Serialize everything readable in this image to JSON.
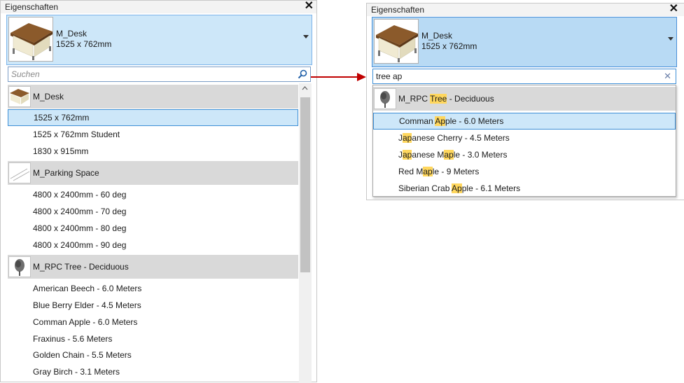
{
  "left_panel": {
    "title": "Eigenschaften",
    "close_glyph": "✕",
    "selector": {
      "name": "M_Desk",
      "size": "1525 x 762mm"
    },
    "search": {
      "placeholder": "Suchen",
      "value": ""
    },
    "list": [
      {
        "kind": "group",
        "label": "M_Desk",
        "thumb": "desk-thumbnail"
      },
      {
        "kind": "item",
        "label": "1525 x 762mm",
        "selected": true
      },
      {
        "kind": "item",
        "label": "1525 x 762mm Student"
      },
      {
        "kind": "item",
        "label": "1830 x 915mm"
      },
      {
        "kind": "group",
        "label": "M_Parking Space",
        "thumb": "parking-thumbnail"
      },
      {
        "kind": "item",
        "label": "4800 x 2400mm - 60 deg"
      },
      {
        "kind": "item",
        "label": "4800 x 2400mm - 70 deg"
      },
      {
        "kind": "item",
        "label": "4800 x 2400mm - 80 deg"
      },
      {
        "kind": "item",
        "label": "4800 x 2400mm - 90 deg"
      },
      {
        "kind": "group",
        "label": "M_RPC Tree - Deciduous",
        "thumb": "tree-thumbnail"
      },
      {
        "kind": "item",
        "label": "American Beech - 6.0 Meters"
      },
      {
        "kind": "item",
        "label": "Blue Berry Elder - 4.5 Meters"
      },
      {
        "kind": "item",
        "label": "Comman Apple - 6.0 Meters"
      },
      {
        "kind": "item",
        "label": "Fraxinus - 5.6 Meters"
      },
      {
        "kind": "item",
        "label": "Golden Chain - 5.5 Meters"
      },
      {
        "kind": "item",
        "label": "Gray Birch - 3.1 Meters"
      }
    ]
  },
  "right_panel": {
    "title": "Eigenschaften",
    "close_glyph": "✕",
    "selector": {
      "name": "M_Desk",
      "size": "1525 x 762mm"
    },
    "search": {
      "placeholder": "",
      "value": "tree ap",
      "clear_glyph": "✕"
    },
    "list": [
      {
        "kind": "group",
        "thumb": "tree-thumbnail",
        "parts": [
          [
            "M_RPC ",
            false
          ],
          [
            "Tree",
            true
          ],
          [
            " - Deciduous",
            false
          ]
        ]
      },
      {
        "kind": "item",
        "selected": true,
        "parts": [
          [
            "Comman ",
            false
          ],
          [
            "Ap",
            true
          ],
          [
            "ple - 6.0 Meters",
            false
          ]
        ]
      },
      {
        "kind": "item",
        "parts": [
          [
            "J",
            false
          ],
          [
            "ap",
            true
          ],
          [
            "anese Cherry - 4.5 Meters",
            false
          ]
        ]
      },
      {
        "kind": "item",
        "parts": [
          [
            "J",
            false
          ],
          [
            "ap",
            true
          ],
          [
            "anese M",
            false
          ],
          [
            "ap",
            true
          ],
          [
            "le - 3.0 Meters",
            false
          ]
        ]
      },
      {
        "kind": "item",
        "parts": [
          [
            "Red M",
            false
          ],
          [
            "ap",
            true
          ],
          [
            "le - 9 Meters",
            false
          ]
        ]
      },
      {
        "kind": "item",
        "parts": [
          [
            "Siberian Crab ",
            false
          ],
          [
            "Ap",
            true
          ],
          [
            "ple - 6.1 Meters",
            false
          ]
        ]
      }
    ]
  },
  "colors": {
    "highlight": "#ffd75e",
    "selection_fill": "#cde7f9",
    "selection_border": "#3d8fd6",
    "group_bg": "#d9d9d9",
    "arrow": "#c00000"
  },
  "icons": {
    "search": "magnifier-icon",
    "close": "close-icon",
    "dropdown": "chevron-down-icon",
    "arrow": "right-arrow-icon"
  }
}
